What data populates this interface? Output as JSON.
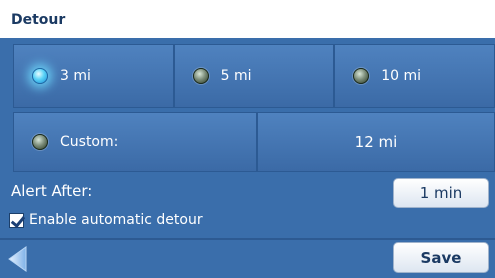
{
  "title": "Detour",
  "distance_options": [
    {
      "label": "3 mi",
      "selected": true
    },
    {
      "label": "5 mi",
      "selected": false
    },
    {
      "label": "10 mi",
      "selected": false
    }
  ],
  "custom": {
    "label": "Custom:",
    "value": "12 mi",
    "selected": false
  },
  "alert": {
    "label": "Alert After:",
    "value": "1 min"
  },
  "auto_detour": {
    "label": "Enable automatic detour",
    "checked": true
  },
  "footer": {
    "save_label": "Save",
    "back_icon": "left-arrow-icon"
  },
  "colors": {
    "panel": "#3a6eab",
    "selected_glow": "#5ad3f7",
    "button": "#ffffff"
  }
}
